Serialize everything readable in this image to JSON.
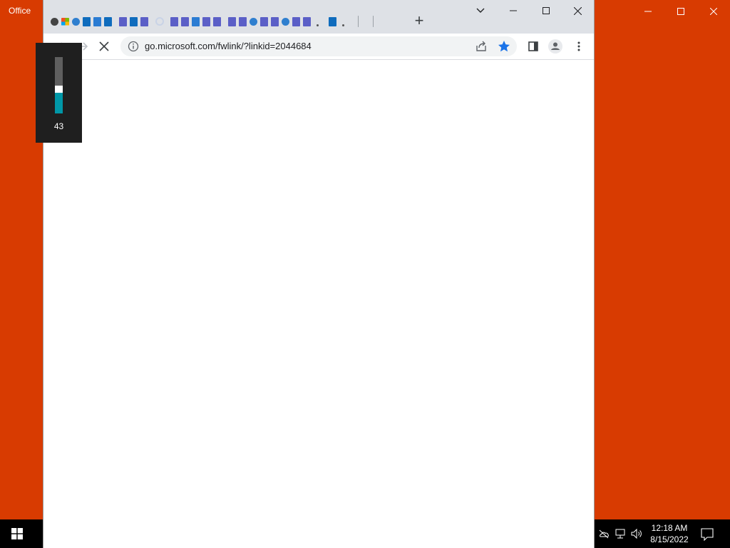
{
  "office": {
    "title": "Office"
  },
  "chrome": {
    "address_url": "go.microsoft.com/fwlink/?linkid=2044684",
    "tab_favicons": [
      "office",
      "ms",
      "edge",
      "outlook",
      "word",
      "outlook",
      "gap",
      "teams",
      "outlook",
      "teams",
      "gap",
      "spin",
      "gap",
      "teams",
      "teams",
      "word",
      "teams",
      "teams",
      "gap",
      "teams",
      "teams",
      "edge",
      "teams",
      "teams",
      "edge",
      "teams",
      "teams",
      "dot",
      "gap",
      "outlook",
      "dot",
      "gap",
      "sep",
      "gap",
      "sep"
    ]
  },
  "volume": {
    "level": 43
  },
  "taskbar": {
    "time": "12:18 AM",
    "date": "8/15/2022"
  },
  "colors": {
    "office_accent": "#d83b01",
    "volume_fill": "#0097a7",
    "star_blue": "#1a73e8"
  }
}
